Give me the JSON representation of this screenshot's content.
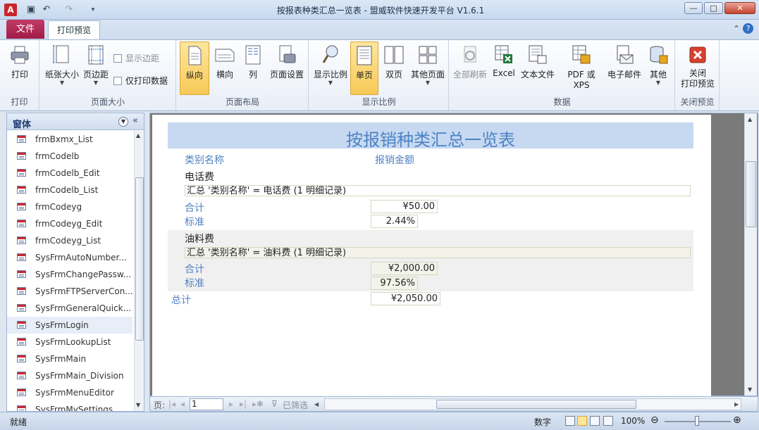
{
  "window": {
    "title": "按报表种类汇总一览表 - 盟威软件快速开发平台 V1.6.1",
    "app_icon": "A",
    "minimize": "—",
    "maximize": "□",
    "close": "✕"
  },
  "tabs": {
    "file": "文件",
    "print_preview": "打印预览"
  },
  "ribbon": {
    "print_group": {
      "label": "打印",
      "print": "打印"
    },
    "page_size_group": {
      "label": "页面大小",
      "paper_size": "纸张大小",
      "margins": "页边距",
      "show_margins": "显示边距",
      "print_data_only": "仅打印数据"
    },
    "layout_group": {
      "label": "页面布局",
      "portrait": "纵向",
      "landscape": "横向",
      "columns": "列",
      "page_setup": "页面设置"
    },
    "zoom_group": {
      "label": "显示比例",
      "zoom": "显示比例",
      "one_page": "单页",
      "two_pages": "双页",
      "more_pages": "其他页面"
    },
    "data_group": {
      "label": "数据",
      "refresh_all": "全部刷新",
      "excel": "Excel",
      "text_file": "文本文件",
      "pdf_xps": "PDF 或 XPS",
      "email": "电子邮件",
      "more": "其他"
    },
    "close_group": {
      "label": "关闭预览",
      "close_preview_line1": "关闭",
      "close_preview_line2": "打印预览"
    }
  },
  "nav_pane": {
    "title": "窗体",
    "items": [
      "frmBxmx_List",
      "frmCodelb",
      "frmCodelb_Edit",
      "frmCodelb_List",
      "frmCodeyg",
      "frmCodeyg_Edit",
      "frmCodeyg_List",
      "SysFrmAutoNumber...",
      "SysFrmChangePassw...",
      "SysFrmFTPServerCon...",
      "SysFrmGeneralQuick...",
      "SysFrmLogin",
      "SysFrmLookupList",
      "SysFrmMain",
      "SysFrmMain_Division",
      "SysFrmMenuEditor",
      "SysFrmMySettings..."
    ],
    "selected_index": 11
  },
  "report": {
    "title": "按报销种类汇总一览表",
    "col_category": "类别名称",
    "col_amount": "报销金额",
    "groups": [
      {
        "name": "电话费",
        "summary": "汇总 '类别名称' = 电话费 (1 明细记录)",
        "total_label": "合计",
        "total_value": "¥50.00",
        "ratio_label": "标准",
        "ratio_value": "2.44%"
      },
      {
        "name": "油料费",
        "summary": "汇总 '类别名称' = 油料费 (1 明细记录)",
        "total_label": "合计",
        "total_value": "¥2,000.00",
        "ratio_label": "标准",
        "ratio_value": "97.56%"
      }
    ],
    "grand_total_label": "总计",
    "grand_total_value": "¥2,050.00"
  },
  "record_nav": {
    "page_label": "页:",
    "page_value": "1",
    "filter": "已筛选"
  },
  "status": {
    "ready": "就绪",
    "numlock": "数字",
    "zoom": "100%"
  }
}
